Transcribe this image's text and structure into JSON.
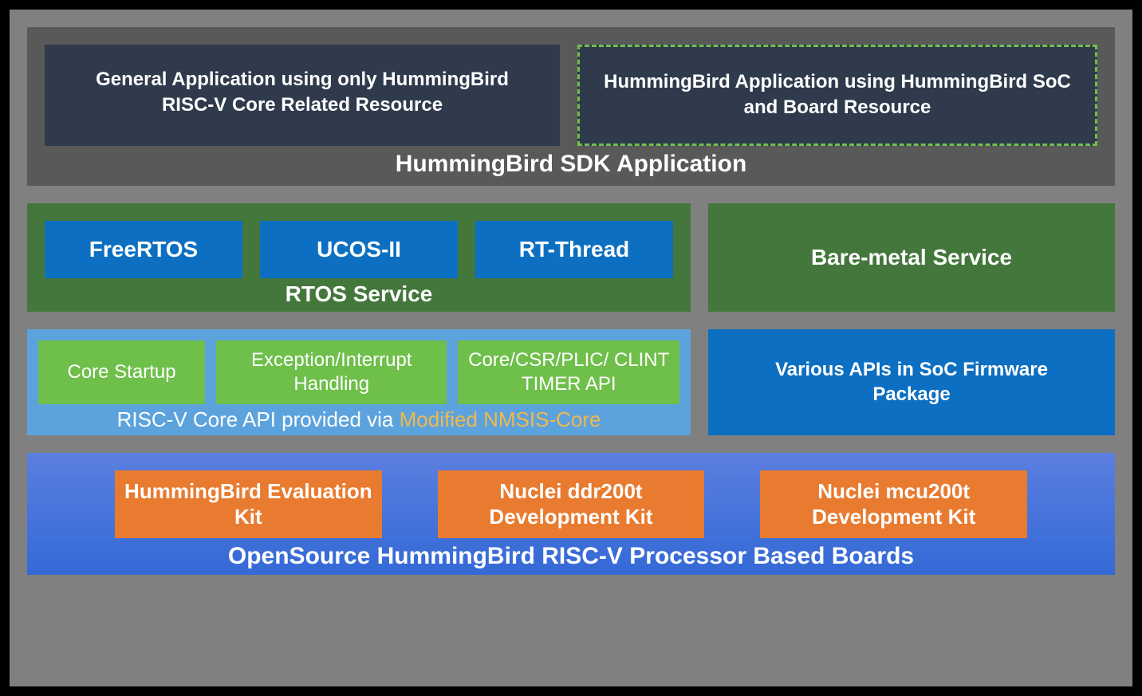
{
  "sdk": {
    "title": "HummingBird SDK Application",
    "general": "General Application using only HummingBird RISC-V Core Related Resource",
    "soc": "HummingBird Application using HummingBird SoC and Board Resource"
  },
  "services": {
    "rtos_title": "RTOS Service",
    "rtos_items": [
      "FreeRTOS",
      "UCOS-II",
      "RT-Thread"
    ],
    "baremetal": "Bare-metal Service"
  },
  "apis": {
    "core_items": [
      "Core Startup",
      "Exception/Interrupt Handling",
      "Core/CSR/PLIC/ CLINT TIMER API"
    ],
    "core_title_prefix": "RISC-V Core API provided via ",
    "core_title_accent": "Modified NMSIS-Core",
    "soc": "Various APIs in SoC Firmware Package"
  },
  "boards": {
    "title": "OpenSource HummingBird RISC-V Processor Based Boards",
    "items": [
      "HummingBird Evaluation Kit",
      "Nuclei ddr200t Development Kit",
      "Nuclei mcu200t Development Kit"
    ]
  }
}
